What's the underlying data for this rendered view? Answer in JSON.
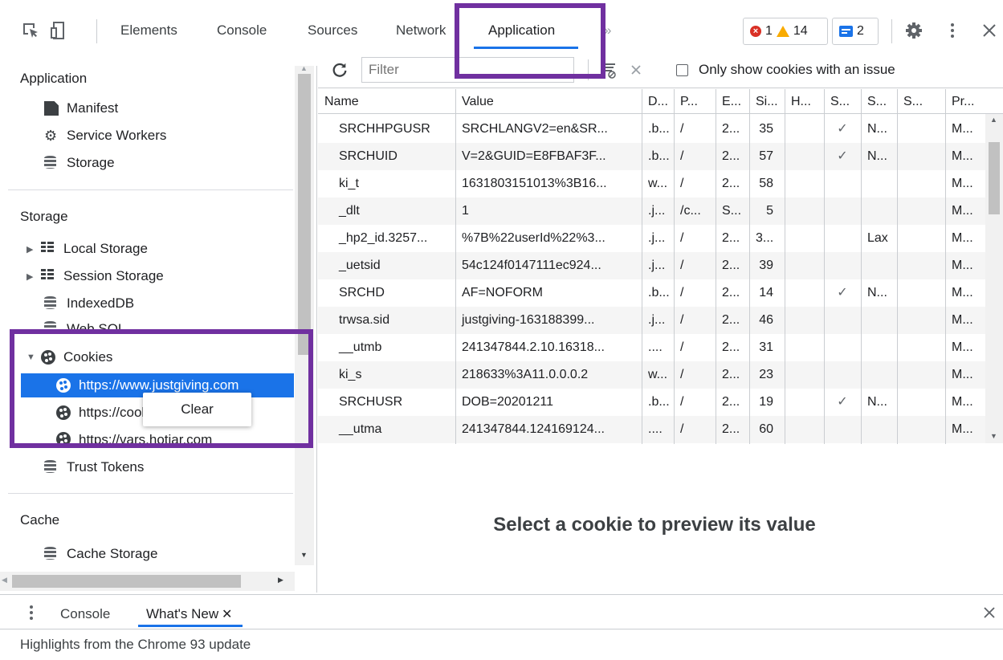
{
  "toolbar": {
    "tabs": [
      {
        "label": "Elements"
      },
      {
        "label": "Console"
      },
      {
        "label": "Sources"
      },
      {
        "label": "Network"
      },
      {
        "label": "Application"
      }
    ],
    "more_tabs": "»",
    "errors": "1",
    "warnings": "14",
    "messages": "2",
    "colors": {
      "accent": "#1a73e8",
      "highlight": "#7030a0",
      "error": "#d93025",
      "warning": "#f9ab00"
    }
  },
  "sidebar": {
    "application_section": {
      "title": "Application",
      "items": [
        {
          "label": "Manifest",
          "icon": "file-icon"
        },
        {
          "label": "Service Workers",
          "icon": "gear-icon"
        },
        {
          "label": "Storage",
          "icon": "database-icon"
        }
      ]
    },
    "storage_section": {
      "title": "Storage",
      "items": [
        {
          "label": "Local Storage",
          "icon": "grid-icon"
        },
        {
          "label": "Session Storage",
          "icon": "grid-icon"
        },
        {
          "label": "IndexedDB",
          "icon": "database-icon"
        },
        {
          "label": "Web SQL",
          "icon": "database-icon"
        }
      ],
      "cookies": {
        "label": "Cookies",
        "origins": [
          {
            "label": "https://www.justgiving.com"
          },
          {
            "label": "https://cookiebot"
          },
          {
            "label": "https://vars.hotjar.com"
          }
        ]
      },
      "trust_tokens": "Trust Tokens"
    },
    "cache_section": {
      "title": "Cache",
      "items": [
        {
          "label": "Cache Storage",
          "icon": "database-icon"
        }
      ]
    },
    "context_menu": {
      "clear_label": "Clear"
    }
  },
  "cookies_panel": {
    "filter_placeholder": "Filter",
    "issue_checkbox_label": "Only show cookies with an issue",
    "columns": [
      "Name",
      "Value",
      "D...",
      "P...",
      "E...",
      "Si...",
      "H...",
      "S...",
      "S...",
      "S...",
      "Pr..."
    ],
    "rows": [
      [
        "SRCHHPGUSR",
        "SRCHLANGV2=en&SR...",
        ".b...",
        "/",
        "2...",
        "35",
        "",
        "✓",
        "N...",
        "",
        "M..."
      ],
      [
        "SRCHUID",
        "V=2&GUID=E8FBAF3F...",
        ".b...",
        "/",
        "2...",
        "57",
        "",
        "✓",
        "N...",
        "",
        "M..."
      ],
      [
        "ki_t",
        "1631803151013%3B16...",
        "w...",
        "/",
        "2...",
        "58",
        "",
        "",
        "",
        "",
        "M..."
      ],
      [
        "_dlt",
        "1",
        ".j...",
        "/c...",
        "S...",
        "5",
        "",
        "",
        "",
        "",
        "M..."
      ],
      [
        "_hp2_id.3257...",
        "%7B%22userId%22%3...",
        ".j...",
        "/",
        "2...",
        "3...",
        "",
        "",
        "Lax",
        "",
        "M..."
      ],
      [
        "_uetsid",
        "54c124f0147111ec924...",
        ".j...",
        "/",
        "2...",
        "39",
        "",
        "",
        "",
        "",
        "M..."
      ],
      [
        "SRCHD",
        "AF=NOFORM",
        ".b...",
        "/",
        "2...",
        "14",
        "",
        "✓",
        "N...",
        "",
        "M..."
      ],
      [
        "trwsa.sid",
        "justgiving-163188399...",
        ".j...",
        "/",
        "2...",
        "46",
        "",
        "",
        "",
        "",
        "M..."
      ],
      [
        "__utmb",
        "241347844.2.10.16318...",
        "....",
        "/",
        "2...",
        "31",
        "",
        "",
        "",
        "",
        "M..."
      ],
      [
        "ki_s",
        "218633%3A11.0.0.0.2",
        "w...",
        "/",
        "2...",
        "23",
        "",
        "",
        "",
        "",
        "M..."
      ],
      [
        "SRCHUSR",
        "DOB=20201211",
        ".b...",
        "/",
        "2...",
        "19",
        "",
        "✓",
        "N...",
        "",
        "M..."
      ],
      [
        "__utma",
        "241347844.124169124...",
        "....",
        "/",
        "2...",
        "60",
        "",
        "",
        "",
        "",
        "M..."
      ]
    ],
    "preview_message": "Select a cookie to preview its value"
  },
  "drawer": {
    "tabs": [
      {
        "label": "Console"
      },
      {
        "label": "What's New"
      }
    ],
    "body_text": "Highlights from the Chrome 93 update"
  }
}
